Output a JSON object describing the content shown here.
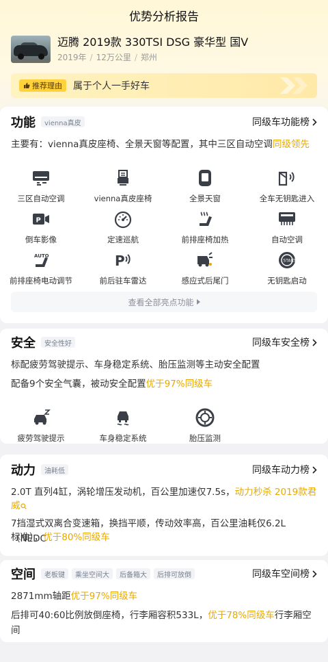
{
  "nav": {
    "title": "优势分析报告"
  },
  "car": {
    "title": "迈腾 2019款 330TSI DSG 豪华型 国V",
    "year": "2019年",
    "mileage": "12万公里",
    "city": "郑州"
  },
  "reason": {
    "badge": "推荐理由",
    "text": "属于个人一手好车"
  },
  "function": {
    "title": "功能",
    "tag": "vienna真皮",
    "rank": "同级车功能榜",
    "desc_main": "主要有：vienna真皮座椅、全景天窗等配置，其中三区自动空调",
    "desc_hl": "级领先",
    "desc_prefix_hl": "同",
    "features": [
      {
        "label": "三区自动空调",
        "icon": "ac-unit-icon"
      },
      {
        "label": "vienna真皮座椅",
        "icon": "leather-seat-icon"
      },
      {
        "label": "全景天窗",
        "icon": "sunroof-icon"
      },
      {
        "label": "全车无钥匙进入",
        "icon": "keyless-entry-icon"
      },
      {
        "label": "倒车影像",
        "icon": "reverse-camera-icon"
      },
      {
        "label": "定速巡航",
        "icon": "cruise-control-icon"
      },
      {
        "label": "前排座椅加热",
        "icon": "seat-heating-icon"
      },
      {
        "label": "自动空调",
        "icon": "auto-ac-icon"
      },
      {
        "label": "前排座椅电动调节",
        "icon": "power-seat-icon"
      },
      {
        "label": "前后驻车雷达",
        "icon": "parking-radar-icon"
      },
      {
        "label": "感应式后尾门",
        "icon": "sensor-tailgate-icon"
      },
      {
        "label": "无钥匙启动",
        "icon": "keyless-start-icon"
      }
    ],
    "more": "查看全部亮点功能"
  },
  "safety": {
    "title": "安全",
    "tag": "安全性好",
    "rank": "同级车安全榜",
    "line1": "标配疲劳驾驶提示、车身稳定系统、胎压监测等主动安全配置",
    "line2_main": "配备9个安全气囊，被动安全配置",
    "line2_hl": "优于97%同级车",
    "features": [
      {
        "label": "疲劳驾驶提示",
        "icon": "fatigue-warning-icon"
      },
      {
        "label": "车身稳定系统",
        "icon": "stability-control-icon"
      },
      {
        "label": "胎压监测",
        "icon": "tire-pressure-icon"
      }
    ]
  },
  "power": {
    "title": "动力",
    "tag": "油耗低",
    "rank": "同级车动力榜",
    "line1_main": "2.0T 直列4缸，涡轮增压发动机，百公里加速仅7.5s，",
    "line1_hl": "动力秒杀 2019款君",
    "line1b_hl": "威",
    "line2": "7挡湿式双离合变速箱，换挡平顺，传动效率高，百公里油耗仅6.2L（NEDC",
    "line3_main": "标准），",
    "line3_hl": "优于80%同级车"
  },
  "space": {
    "title": "空间",
    "tags": [
      "老板键",
      "乘坐空间大",
      "后备箱大",
      "后排可放倒"
    ],
    "rank": "同级车空间榜",
    "line1_main": "2871mm轴距",
    "line1_hl": "优于97%同级车",
    "line2_main": "后排可40:60比例放倒座椅，行李厢容积533L，",
    "line2_hl": "优于78%同级车",
    "line2_tail": "行李厢空间"
  },
  "colors": {
    "accent": "#e8a900",
    "badge": "#ffd13a"
  }
}
